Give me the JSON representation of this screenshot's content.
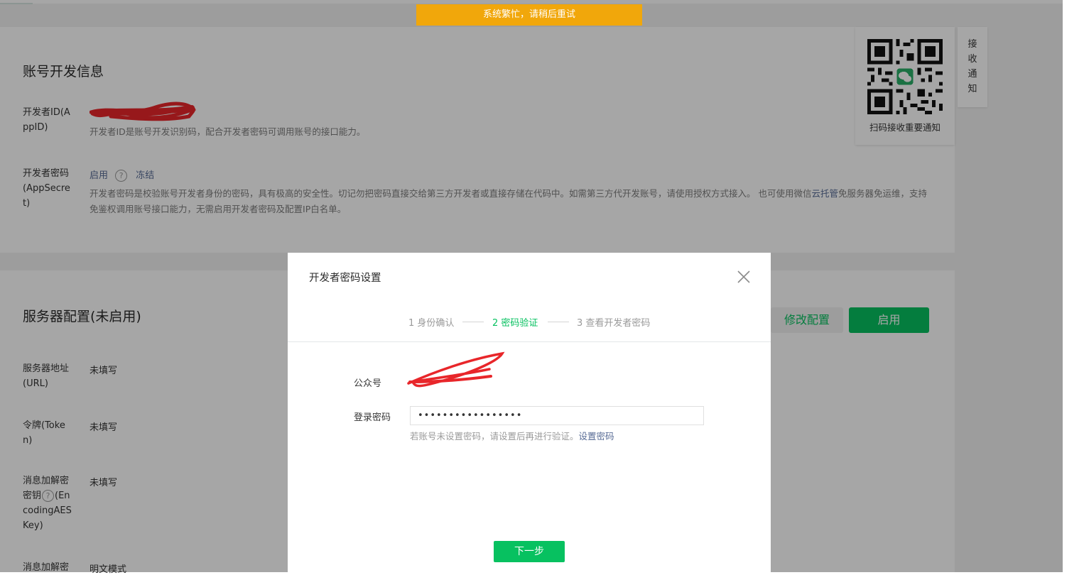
{
  "toast": {
    "text": "系统繁忙，请稍后重试"
  },
  "account_dev": {
    "title": "账号开发信息",
    "appid": {
      "label": "开发者ID(AppID)",
      "desc": "开发者ID是账号开发识别码，配合开发者密码可调用账号的接口能力。"
    },
    "appsecret": {
      "label": "开发者密码(AppSecret)",
      "enable_link": "启用",
      "help": "?",
      "freeze_link": "冻结",
      "desc_part1": "开发者密码是校验账号开发者身份的密码，具有极高的安全性。切记勿把密码直接交给第三方开发者或直接存储在代码中。如需第三方代开发账号，请使用授权方式接入。 也可使用微信",
      "desc_link": "云托管",
      "desc_part2": "免服务器免运维，支持免鉴权调用账号接口能力，无需启用开发者密码及配置IP白名单。"
    }
  },
  "qr_notice": {
    "caption": "扫码接收重要通知",
    "side_tab": "接收通知"
  },
  "server_config": {
    "title": "服务器配置(未启用)",
    "edit_button": "修改配置",
    "enable_button": "启用",
    "rows": [
      {
        "label": "服务器地址(URL)",
        "value": "未填写"
      },
      {
        "label": "令牌(Token)",
        "value": "未填写"
      },
      {
        "label_before_help": "消息加解密密钥",
        "help": "?",
        "label_after_help": "(EncodingAESKey)",
        "value": "未填写"
      },
      {
        "label": "消息加解密",
        "value": "明文模式"
      }
    ]
  },
  "dialog": {
    "title": "开发者密码设置",
    "steps": [
      {
        "label": "1 身份确认",
        "state": "done"
      },
      {
        "label": "2 密码验证",
        "state": "active"
      },
      {
        "label": "3 查看开发者密码",
        "state": "pending"
      }
    ],
    "account_label": "公众号",
    "password_label": "登录密码",
    "password_value": "•••••••••••••••••",
    "hint_text": "若账号未设置密码，请设置后再进行验证。",
    "hint_link": "设置密码",
    "next_button": "下一步"
  },
  "colors": {
    "brand_green": "#07c160",
    "link_blue": "#576b95",
    "toast_orange": "#f1a70b",
    "redaction_red": "#e8262a"
  }
}
